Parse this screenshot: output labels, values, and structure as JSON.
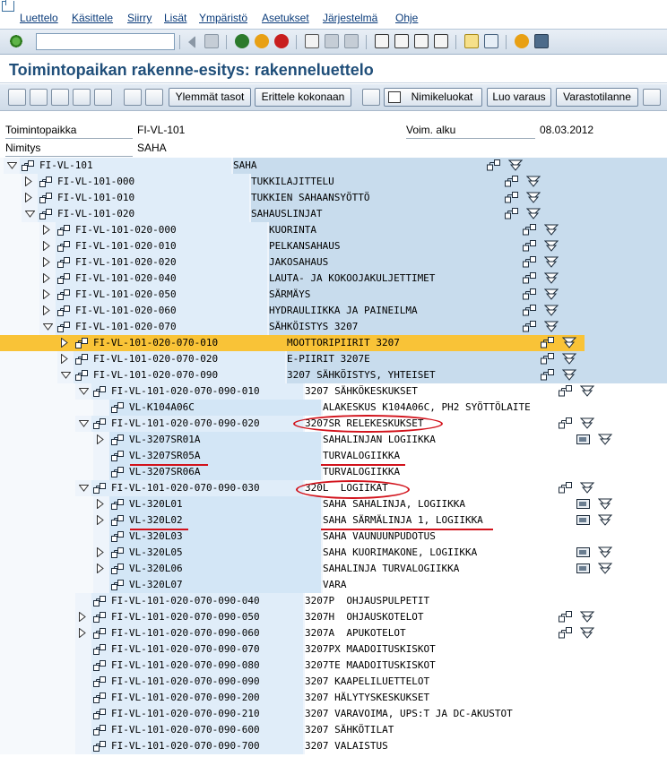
{
  "menu": {
    "items": [
      "Luettelo",
      "Käsittele",
      "Siirry",
      "Lisät",
      "Ympäristö",
      "Asetukset",
      "Järjestelmä",
      "Ohje"
    ]
  },
  "title": "Toimintopaikan rakenne-esitys: rakenneluettelo",
  "app_toolbar": {
    "btn_higher_levels": "Ylemmät tasot",
    "btn_expand_all": "Erittele kokonaan",
    "btn_item_classes": "Nimikeluokat",
    "btn_create_reservation": "Luo varaus",
    "btn_stock_status": "Varastotilanne"
  },
  "header": {
    "location_label": "Toimintopaikka",
    "location_value": "FI-VL-101",
    "valid_from_label": "Voim. alku",
    "valid_from_value": "08.03.2012",
    "name_label": "Nimitys",
    "name_value": "SAHA"
  },
  "colors": {
    "tree_bg_light": "#e0edf9",
    "tree_bg_mid": "#c8dced",
    "selected_row": "#f9c337",
    "highlight_ellipse": "#d2121b",
    "title_text": "#1f4e79"
  },
  "tree": {
    "rows": [
      {
        "id": "FI-VL-101",
        "desc": "SAHA",
        "level": 0,
        "expander": "open",
        "node_icon": "hierarchy-icon",
        "trail": [
          "hierarchy-icon",
          "filter-down-icon"
        ]
      },
      {
        "id": "FI-VL-101-000",
        "desc": "TUKKILAJITTELU",
        "level": 1,
        "expander": "closed",
        "node_icon": "hierarchy-icon",
        "trail": [
          "hierarchy-icon",
          "filter-down-icon"
        ]
      },
      {
        "id": "FI-VL-101-010",
        "desc": "TUKKIEN SAHAANSYÖTTÖ",
        "level": 1,
        "expander": "closed",
        "node_icon": "hierarchy-icon",
        "trail": [
          "hierarchy-icon",
          "filter-down-icon"
        ]
      },
      {
        "id": "FI-VL-101-020",
        "desc": "SAHAUSLINJAT",
        "level": 1,
        "expander": "open",
        "node_icon": "hierarchy-icon",
        "trail": [
          "hierarchy-icon",
          "filter-down-icon"
        ]
      },
      {
        "id": "FI-VL-101-020-000",
        "desc": "KUORINTA",
        "level": 2,
        "expander": "closed",
        "node_icon": "hierarchy-icon",
        "trail": [
          "hierarchy-icon",
          "filter-down-icon"
        ]
      },
      {
        "id": "FI-VL-101-020-010",
        "desc": "PELKANSAHAUS",
        "level": 2,
        "expander": "closed",
        "node_icon": "hierarchy-icon",
        "trail": [
          "hierarchy-icon",
          "filter-down-icon"
        ]
      },
      {
        "id": "FI-VL-101-020-020",
        "desc": "JAKOSAHAUS",
        "level": 2,
        "expander": "closed",
        "node_icon": "hierarchy-icon",
        "trail": [
          "hierarchy-icon",
          "filter-down-icon"
        ]
      },
      {
        "id": "FI-VL-101-020-040",
        "desc": "LAUTA- JA KOKOOJAKULJETTIMET",
        "level": 2,
        "expander": "closed",
        "node_icon": "hierarchy-icon",
        "trail": [
          "hierarchy-icon",
          "filter-down-icon"
        ]
      },
      {
        "id": "FI-VL-101-020-050",
        "desc": "SÄRMÄYS",
        "level": 2,
        "expander": "closed",
        "node_icon": "hierarchy-icon",
        "trail": [
          "hierarchy-icon",
          "filter-down-icon"
        ]
      },
      {
        "id": "FI-VL-101-020-060",
        "desc": "HYDRAULIIKKA JA PAINEILMA",
        "level": 2,
        "expander": "closed",
        "node_icon": "hierarchy-icon",
        "trail": [
          "hierarchy-icon",
          "filter-down-icon"
        ]
      },
      {
        "id": "FI-VL-101-020-070",
        "desc": "SÄHKÖISTYS 3207",
        "level": 2,
        "expander": "open",
        "node_icon": "hierarchy-icon",
        "trail": [
          "hierarchy-icon",
          "filter-down-icon"
        ]
      },
      {
        "id": "FI-VL-101-020-070-010",
        "desc": "MOOTTORIPIIRIT 3207",
        "level": 3,
        "expander": "closed",
        "node_icon": "hierarchy-icon",
        "trail": [
          "hierarchy-icon",
          "filter-down-icon"
        ],
        "selected": true
      },
      {
        "id": "FI-VL-101-020-070-020",
        "desc": "E-PIIRIT 3207E",
        "level": 3,
        "expander": "closed",
        "node_icon": "hierarchy-icon",
        "trail": [
          "hierarchy-icon",
          "filter-down-icon"
        ]
      },
      {
        "id": "FI-VL-101-020-070-090",
        "desc": "3207 SÄHKÖISTYS, YHTEISET",
        "level": 3,
        "expander": "open",
        "node_icon": "hierarchy-icon",
        "trail": [
          "hierarchy-icon",
          "filter-down-icon"
        ]
      },
      {
        "id": "FI-VL-101-020-070-090-010",
        "desc": "3207 SÄHKÖKESKUKSET",
        "level": 4,
        "expander": "open",
        "node_icon": "hierarchy-icon",
        "trail": [
          "hierarchy-icon",
          "filter-down-icon"
        ]
      },
      {
        "id": "VL-K104A06C",
        "desc": "ALAKESKUS K104A06C, PH2 SYÖTTÖLAITE",
        "level": 5,
        "expander": "none",
        "node_icon": "hierarchy-icon",
        "trail": []
      },
      {
        "id": "FI-VL-101-020-070-090-020",
        "desc": "3207SR RELEKESKUKSET",
        "level": 4,
        "expander": "open",
        "node_icon": "hierarchy-icon",
        "trail": [
          "hierarchy-icon",
          "filter-down-icon"
        ]
      },
      {
        "id": "VL-3207SR01A",
        "desc": "SAHALINJAN LOGIIKKA",
        "level": 5,
        "expander": "closed",
        "node_icon": "hierarchy-icon",
        "trail": [
          "equipment-icon",
          "filter-down-icon"
        ]
      },
      {
        "id": "VL-3207SR05A",
        "desc": "TURVALOGIIKKA",
        "level": 5,
        "expander": "none",
        "node_icon": "hierarchy-icon",
        "trail": []
      },
      {
        "id": "VL-3207SR06A",
        "desc": "TURVALOGIIKKA",
        "level": 5,
        "expander": "none",
        "node_icon": "hierarchy-icon",
        "trail": []
      },
      {
        "id": "FI-VL-101-020-070-090-030",
        "desc": "320L  LOGIIKAT",
        "level": 4,
        "expander": "open",
        "node_icon": "hierarchy-icon",
        "trail": [
          "hierarchy-icon",
          "filter-down-icon"
        ]
      },
      {
        "id": "VL-320L01",
        "desc": "SAHA SAHALINJA, LOGIIKKA",
        "level": 5,
        "expander": "closed",
        "node_icon": "hierarchy-icon",
        "trail": [
          "equipment-icon",
          "filter-down-icon"
        ]
      },
      {
        "id": "VL-320L02",
        "desc": "SAHA SÄRMÄLINJA 1, LOGIIKKA",
        "level": 5,
        "expander": "closed",
        "node_icon": "hierarchy-icon",
        "trail": [
          "equipment-icon",
          "filter-down-icon"
        ]
      },
      {
        "id": "VL-320L03",
        "desc": "SAHA VAUNUUNPUDOTUS",
        "level": 5,
        "expander": "none",
        "node_icon": "hierarchy-icon",
        "trail": []
      },
      {
        "id": "VL-320L05",
        "desc": "SAHA KUORIMAKONE, LOGIIKKA",
        "level": 5,
        "expander": "closed",
        "node_icon": "hierarchy-icon",
        "trail": [
          "equipment-icon",
          "filter-down-icon"
        ]
      },
      {
        "id": "VL-320L06",
        "desc": "SAHALINJA TURVALOGIIKKA",
        "level": 5,
        "expander": "closed",
        "node_icon": "hierarchy-icon",
        "trail": [
          "equipment-icon",
          "filter-down-icon"
        ]
      },
      {
        "id": "VL-320L07",
        "desc": "VARA",
        "level": 5,
        "expander": "none",
        "node_icon": "hierarchy-icon",
        "trail": []
      },
      {
        "id": "FI-VL-101-020-070-090-040",
        "desc": "3207P  OHJAUSPULPETIT",
        "level": 4,
        "expander": "none",
        "node_icon": "hierarchy-icon",
        "trail": []
      },
      {
        "id": "FI-VL-101-020-070-090-050",
        "desc": "3207H  OHJAUSKOTELOT",
        "level": 4,
        "expander": "closed",
        "node_icon": "hierarchy-icon",
        "trail": [
          "hierarchy-icon",
          "filter-down-icon"
        ]
      },
      {
        "id": "FI-VL-101-020-070-090-060",
        "desc": "3207A  APUKOTELOT",
        "level": 4,
        "expander": "closed",
        "node_icon": "hierarchy-icon",
        "trail": [
          "hierarchy-icon",
          "filter-down-icon"
        ]
      },
      {
        "id": "FI-VL-101-020-070-090-070",
        "desc": "3207PX MAADOITUSKISKOT",
        "level": 4,
        "expander": "none",
        "node_icon": "hierarchy-icon",
        "trail": []
      },
      {
        "id": "FI-VL-101-020-070-090-080",
        "desc": "3207TE MAADOITUSKISKOT",
        "level": 4,
        "expander": "none",
        "node_icon": "hierarchy-icon",
        "trail": []
      },
      {
        "id": "FI-VL-101-020-070-090-090",
        "desc": "3207 KAAPELILUETTELOT",
        "level": 4,
        "expander": "none",
        "node_icon": "hierarchy-icon",
        "trail": []
      },
      {
        "id": "FI-VL-101-020-070-090-200",
        "desc": "3207 HÄLYTYSKESKUKSET",
        "level": 4,
        "expander": "none",
        "node_icon": "hierarchy-icon",
        "trail": []
      },
      {
        "id": "FI-VL-101-020-070-090-210",
        "desc": "3207 VARAVOIMA, UPS:T JA DC-AKUSTOT",
        "level": 4,
        "expander": "none",
        "node_icon": "hierarchy-icon",
        "trail": []
      },
      {
        "id": "FI-VL-101-020-070-090-600",
        "desc": "3207 SÄHKÖTILAT",
        "level": 4,
        "expander": "none",
        "node_icon": "hierarchy-icon",
        "trail": []
      },
      {
        "id": "FI-VL-101-020-070-090-700",
        "desc": "3207 VALAISTUS",
        "level": 4,
        "expander": "none",
        "node_icon": "hierarchy-icon",
        "trail": []
      }
    ]
  }
}
